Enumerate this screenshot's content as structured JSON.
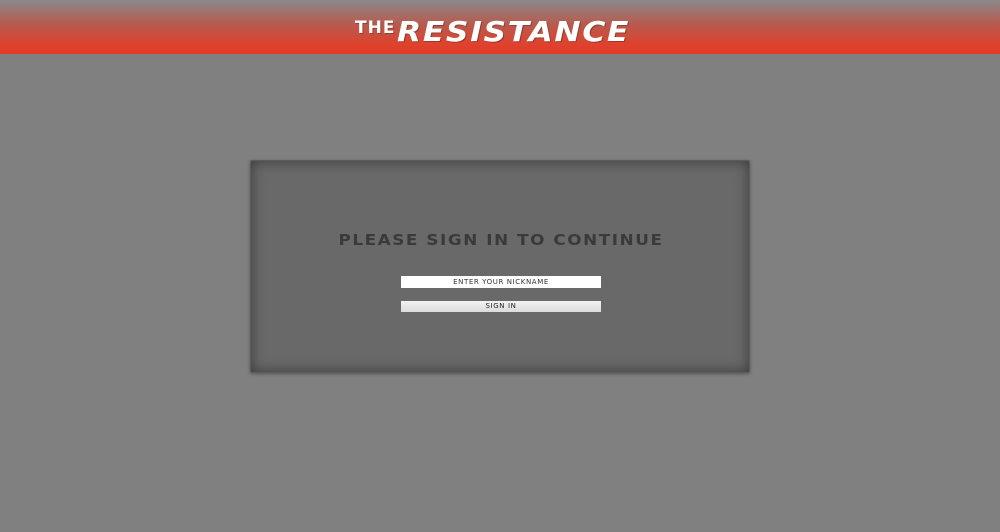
{
  "header": {
    "logo_the": "The",
    "logo_main": "Resistance"
  },
  "signin": {
    "title": "Please sign in to continue",
    "nickname_placeholder": "ENTER YOUR NICKNAME",
    "nickname_value": "",
    "button_label": "Sign In"
  },
  "colors": {
    "header_accent": "#e23c27",
    "page_background": "#808080",
    "panel_background": "#696969"
  }
}
